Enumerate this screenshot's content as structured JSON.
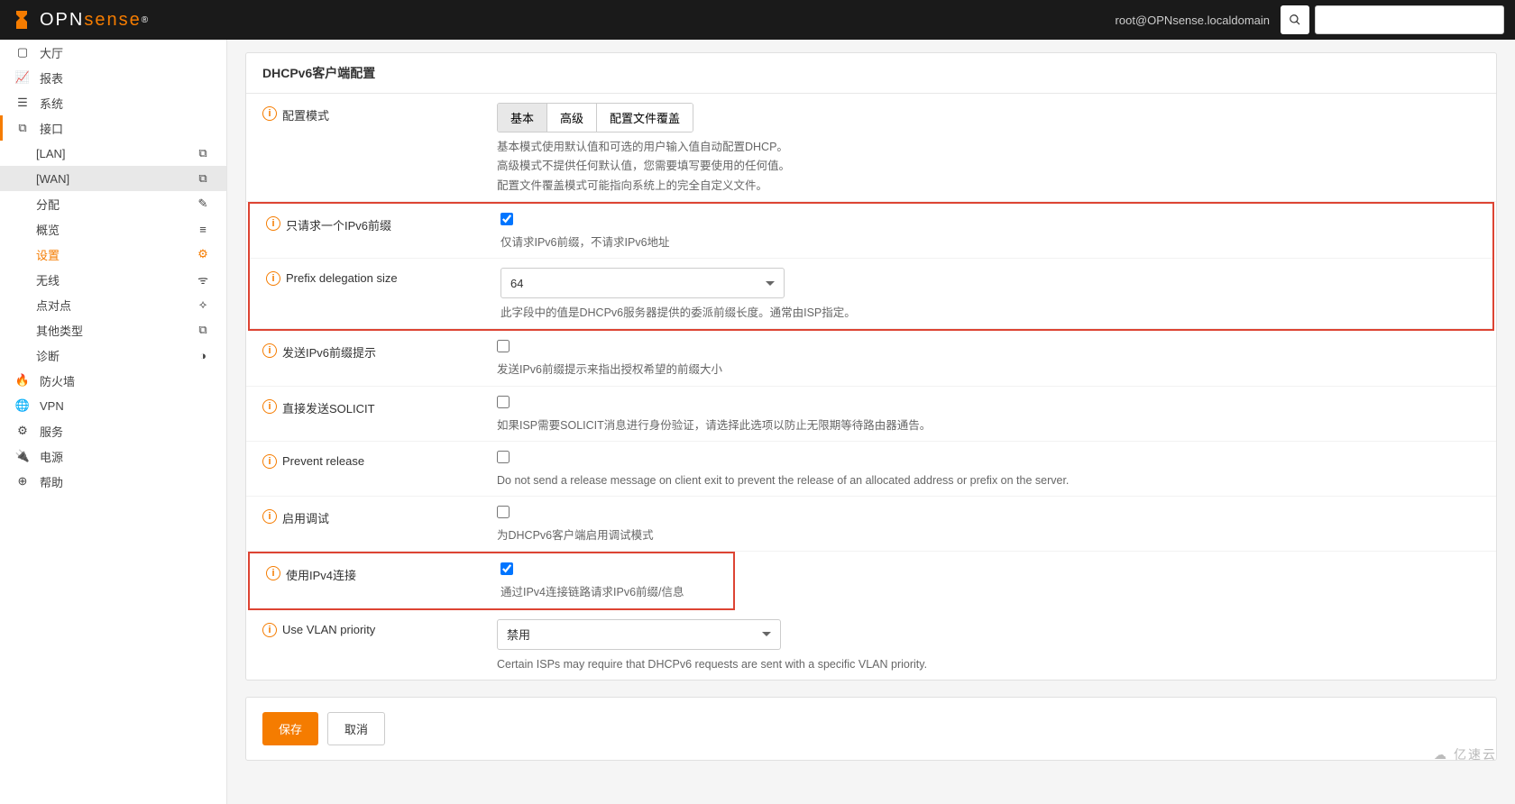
{
  "header": {
    "brand_left": "OPN",
    "brand_right": "sense",
    "user": "root@OPNsense.localdomain"
  },
  "sidebar": {
    "items": [
      {
        "icon": "monitor",
        "label": "大厅"
      },
      {
        "icon": "chart",
        "label": "报表"
      },
      {
        "icon": "list",
        "label": "系统"
      },
      {
        "icon": "sitemap",
        "label": "接口",
        "active": true
      }
    ],
    "sub": [
      {
        "label": "[LAN]",
        "icon": "sitemap"
      },
      {
        "label": "[WAN]",
        "icon": "sitemap",
        "selected": true
      },
      {
        "label": "分配",
        "icon": "pencil"
      },
      {
        "label": "概览",
        "icon": "bars"
      },
      {
        "label": "设置",
        "icon": "gears",
        "orange": true
      },
      {
        "label": "无线",
        "icon": "wifi"
      },
      {
        "label": "点对点",
        "icon": "dash"
      },
      {
        "label": "其他类型",
        "icon": "sitemap"
      },
      {
        "label": "诊断",
        "icon": "diag"
      }
    ],
    "bottom": [
      {
        "icon": "fire",
        "label": "防火墙"
      },
      {
        "icon": "globe",
        "label": "VPN"
      },
      {
        "icon": "gear",
        "label": "服务"
      },
      {
        "icon": "plug",
        "label": "电源"
      },
      {
        "icon": "life",
        "label": "帮助"
      }
    ]
  },
  "panel": {
    "title": "DHCPv6客户端配置",
    "mode": {
      "label": "配置模式",
      "options": [
        "基本",
        "高级",
        "配置文件覆盖"
      ],
      "active": 0,
      "help1": "基本模式使用默认值和可选的用户输入值自动配置DHCP。",
      "help2": "高级模式不提供任何默认值，您需要填写要使用的任何值。",
      "help3": "配置文件覆盖模式可能指向系统上的完全自定义文件。"
    },
    "only_prefix": {
      "label": "只请求一个IPv6前缀",
      "checked": true,
      "help": "仅请求IPv6前缀，不请求IPv6地址"
    },
    "prefix_size": {
      "label": "Prefix delegation size",
      "value": "64",
      "help": "此字段中的值是DHCPv6服务器提供的委派前缀长度。通常由ISP指定。"
    },
    "prefix_hint": {
      "label": "发送IPv6前缀提示",
      "checked": false,
      "help": "发送IPv6前缀提示来指出授权希望的前缀大小"
    },
    "solicit": {
      "label": "直接发送SOLICIT",
      "checked": false,
      "help": "如果ISP需要SOLICIT消息进行身份验证，请选择此选项以防止无限期等待路由器通告。"
    },
    "prevent": {
      "label": "Prevent release",
      "checked": false,
      "help": "Do not send a release message on client exit to prevent the release of an allocated address or prefix on the server."
    },
    "debug": {
      "label": "启用调试",
      "checked": false,
      "help": "为DHCPv6客户端启用调试模式"
    },
    "ipv4": {
      "label": "使用IPv4连接",
      "checked": true,
      "help": "通过IPv4连接链路请求IPv6前缀/信息"
    },
    "vlan": {
      "label": "Use VLAN priority",
      "value": "禁用",
      "help": "Certain ISPs may require that DHCPv6 requests are sent with a specific VLAN priority."
    },
    "save": "保存",
    "cancel": "取消"
  },
  "watermark": "亿速云"
}
